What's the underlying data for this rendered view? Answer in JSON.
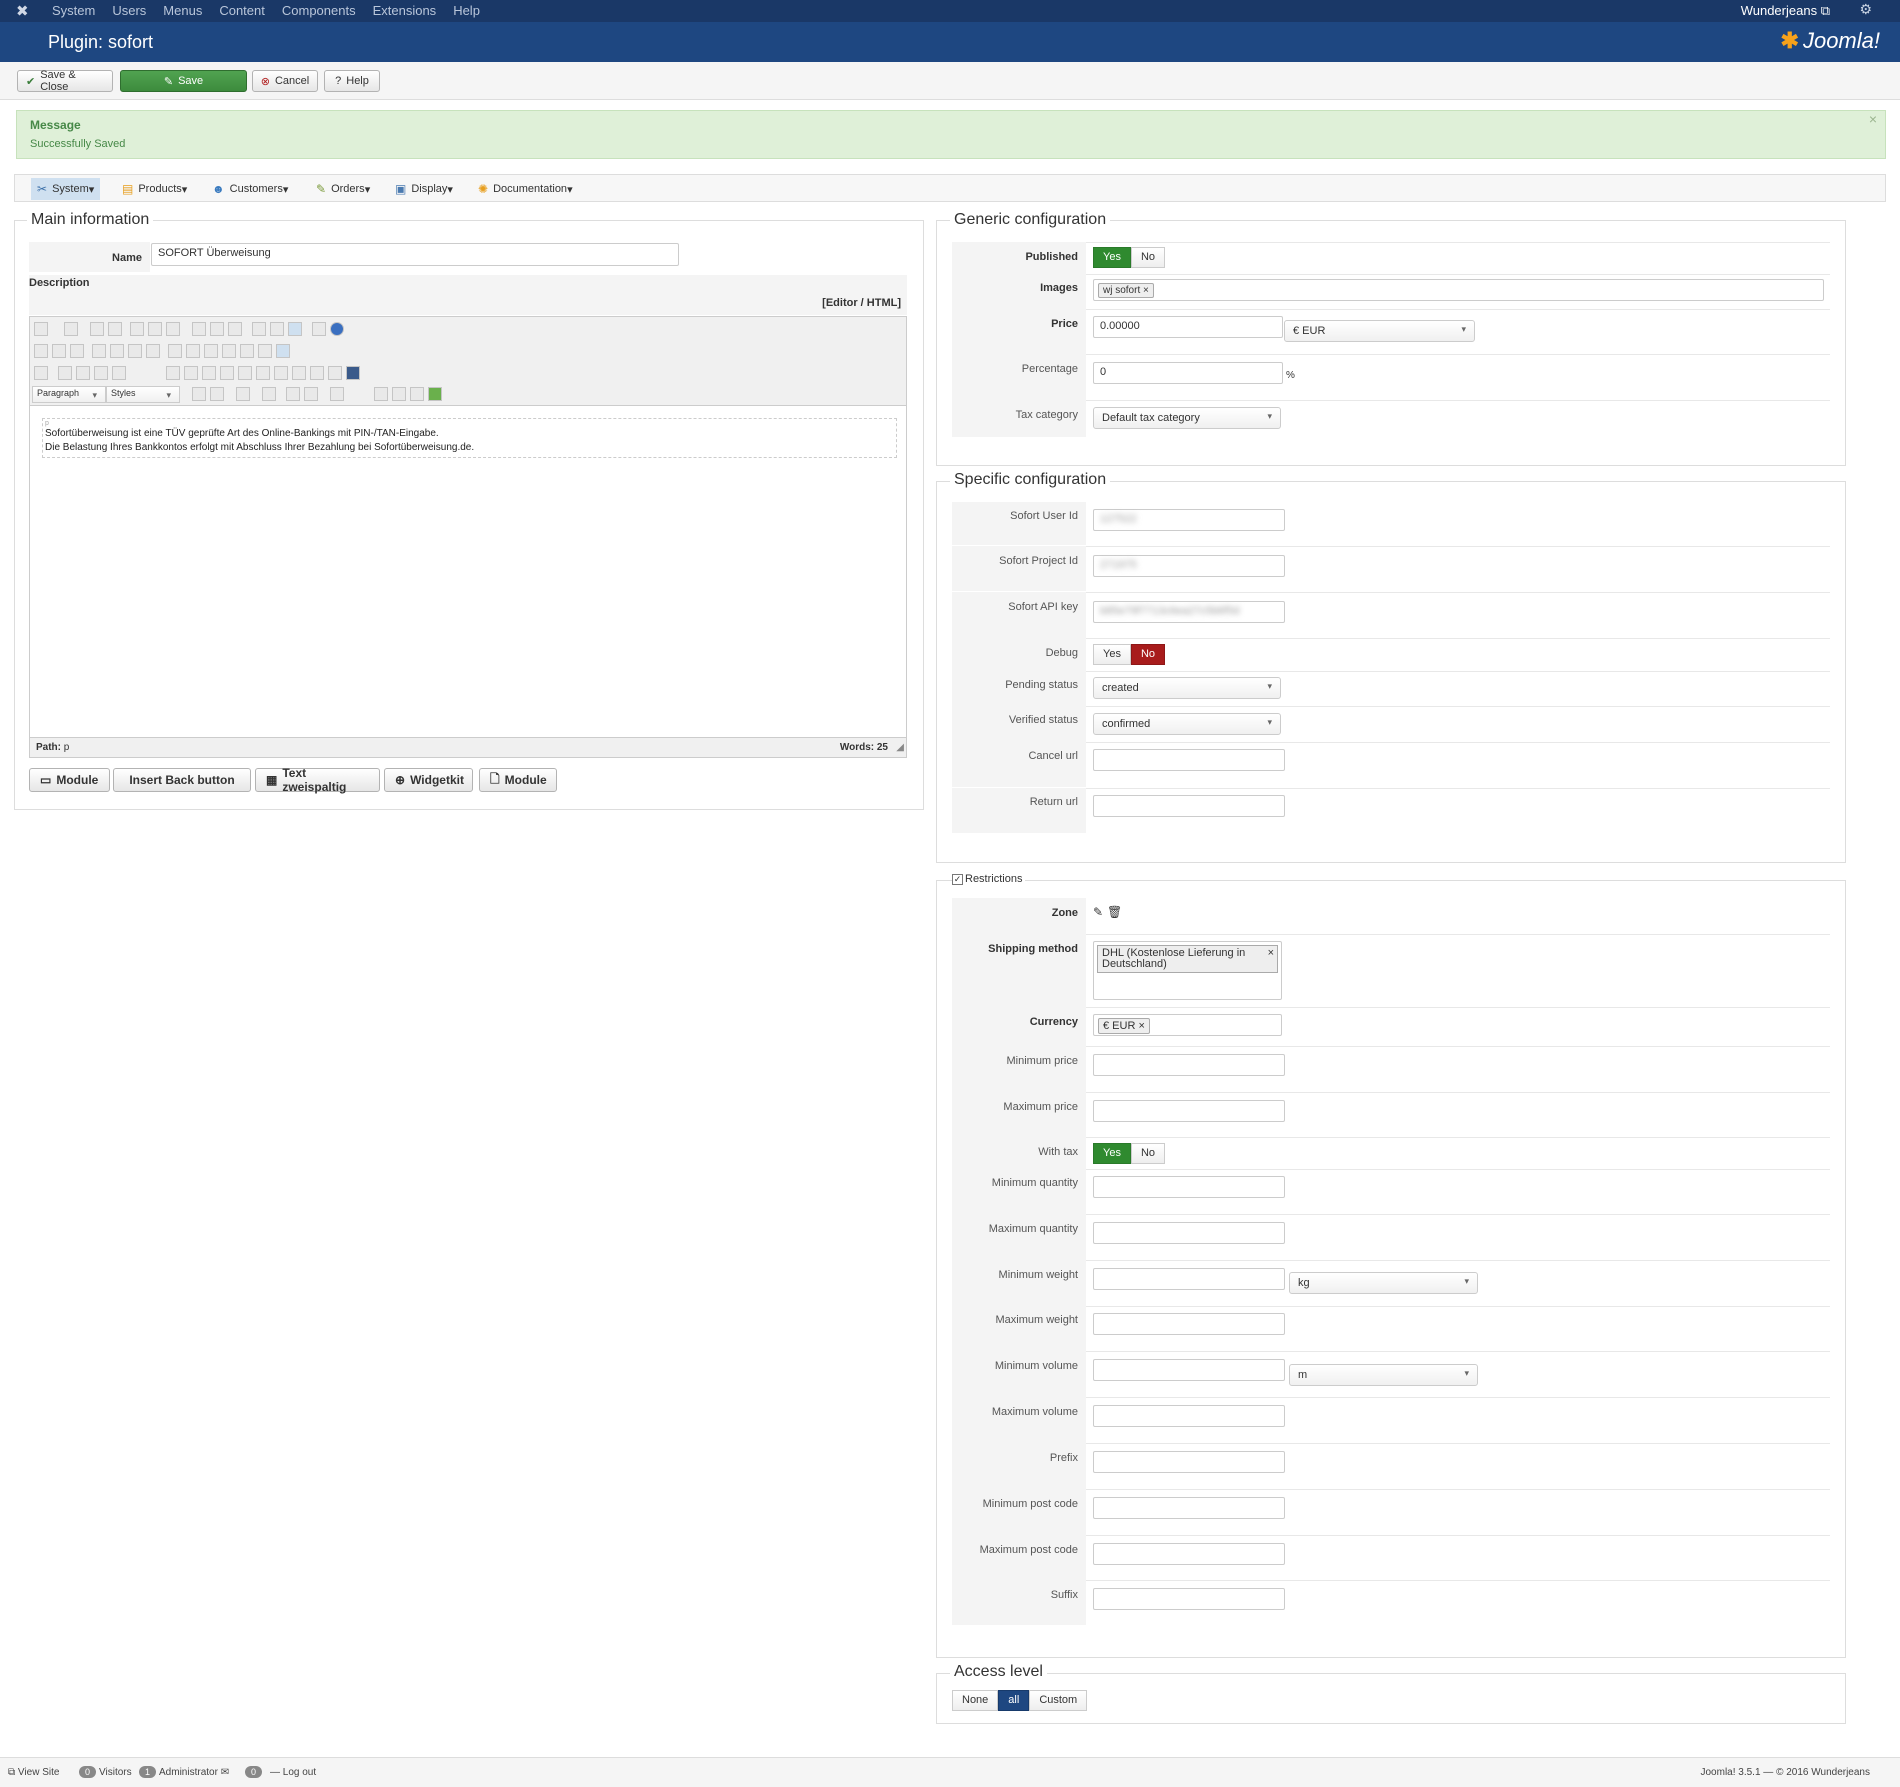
{
  "topbar": {
    "menu": [
      "System",
      "Users",
      "Menus",
      "Content",
      "Components",
      "Extensions",
      "Help"
    ],
    "site": "Wunderjeans"
  },
  "header": {
    "title": "Plugin: sofort",
    "logo": "Joomla!"
  },
  "toolbar": {
    "save_close": "Save & Close",
    "save": "Save",
    "cancel": "Cancel",
    "help": "Help"
  },
  "message": {
    "heading": "Message",
    "text": "Successfully Saved"
  },
  "nav": [
    "System",
    "Products",
    "Customers",
    "Orders",
    "Display",
    "Documentation"
  ],
  "main": {
    "legend": "Main information",
    "name_label": "Name",
    "name_value": "SOFORT Überweisung",
    "description_label": "Description",
    "editor_toggle": "[Editor / HTML]",
    "format_select": "Paragraph",
    "styles_select": "Styles",
    "content_tag": "p",
    "content_line1": "Sofortüberweisung ist eine TÜV geprüfte Art des Online-Bankings mit PIN-/TAN-Eingabe.",
    "content_line2": "Die Belastung Ihres Bankkontos erfolgt mit Abschluss Ihrer Bezahlung bei Sofortüberweisung.de.",
    "path_label": "Path:",
    "path_value": "p",
    "words": "Words: 25",
    "buttons": [
      "Module",
      "Insert Back button",
      "Text zweispaltig",
      "Widgetkit",
      "Module"
    ]
  },
  "generic": {
    "legend": "Generic configuration",
    "published_label": "Published",
    "yes": "Yes",
    "no": "No",
    "images_label": "Images",
    "images_tag": "wj sofort",
    "price_label": "Price",
    "price_value": "0.00000",
    "currency_select": "€ EUR",
    "percentage_label": "Percentage",
    "percentage_value": "0",
    "percent_sign": "%",
    "tax_label": "Tax category",
    "tax_value": "Default tax category"
  },
  "specific": {
    "legend": "Specific configuration",
    "user_id_label": "Sofort User Id",
    "user_id_value": "127522",
    "project_id_label": "Sofort Project Id",
    "project_id_value": "271975",
    "api_key_label": "Sofort API key",
    "api_key_value": "b85e79f7713c6ea27c5b6f5d",
    "debug_label": "Debug",
    "pending_label": "Pending status",
    "pending_value": "created",
    "verified_label": "Verified status",
    "verified_value": "confirmed",
    "cancel_label": "Cancel url",
    "return_label": "Return url"
  },
  "restrictions": {
    "legend": "Restrictions",
    "zone_label": "Zone",
    "shipping_label": "Shipping method",
    "shipping_tag": "DHL (Kostenlose Lieferung in Deutschland)",
    "currency_label": "Currency",
    "currency_tag": "€ EUR",
    "min_price": "Minimum price",
    "max_price": "Maximum price",
    "with_tax": "With tax",
    "min_qty": "Minimum quantity",
    "max_qty": "Maximum quantity",
    "min_weight": "Minimum weight",
    "weight_unit": "kg",
    "max_weight": "Maximum weight",
    "min_volume": "Minimum volume",
    "volume_unit": "m",
    "max_volume": "Maximum volume",
    "prefix": "Prefix",
    "min_post": "Minimum post code",
    "max_post": "Maximum post code",
    "suffix": "Suffix"
  },
  "access": {
    "legend": "Access level",
    "options": [
      "None",
      "all",
      "Custom"
    ]
  },
  "footer": {
    "view_site": "View Site",
    "visitors_count": "0",
    "visitors": "Visitors",
    "admin_count": "1",
    "admin": "Administrator",
    "msg_count": "0",
    "logout": "Log out",
    "version": "Joomla! 3.5.1 — © 2016 Wunderjeans"
  }
}
